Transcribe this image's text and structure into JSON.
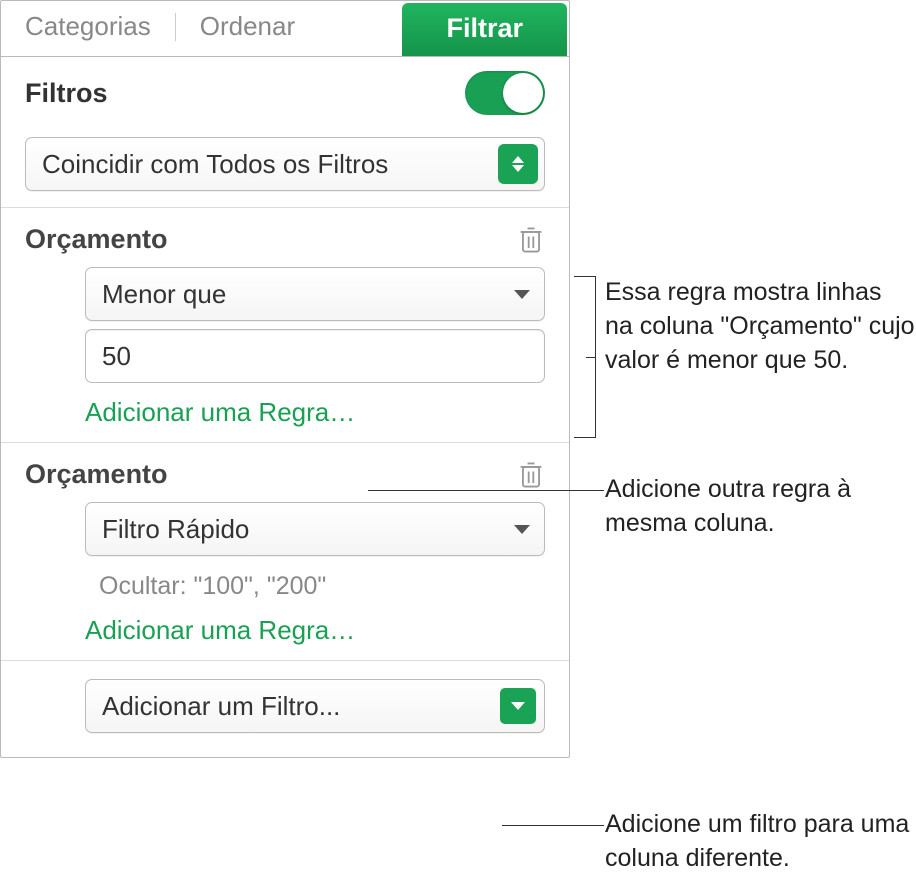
{
  "tabs": {
    "categories": "Categorias",
    "sort": "Ordenar",
    "filter": "Filtrar"
  },
  "filters_header": "Filtros",
  "match_mode": "Coincidir com Todos os Filtros",
  "groups": [
    {
      "title": "Orçamento",
      "rule_type": "Menor que",
      "value": "50",
      "add_rule": "Adicionar uma Regra…"
    },
    {
      "title": "Orçamento",
      "rule_type": "Filtro Rápido",
      "hide_text": "Ocultar: \"100\", \"200\"",
      "add_rule": "Adicionar uma Regra…"
    }
  ],
  "add_filter": "Adicionar um Filtro...",
  "callouts": {
    "c1": "Essa regra mostra linhas na coluna \"Orçamento\" cujo valor é menor que 50.",
    "c2": "Adicione outra regra à mesma coluna.",
    "c3": "Adicione um filtro para uma coluna diferente."
  }
}
